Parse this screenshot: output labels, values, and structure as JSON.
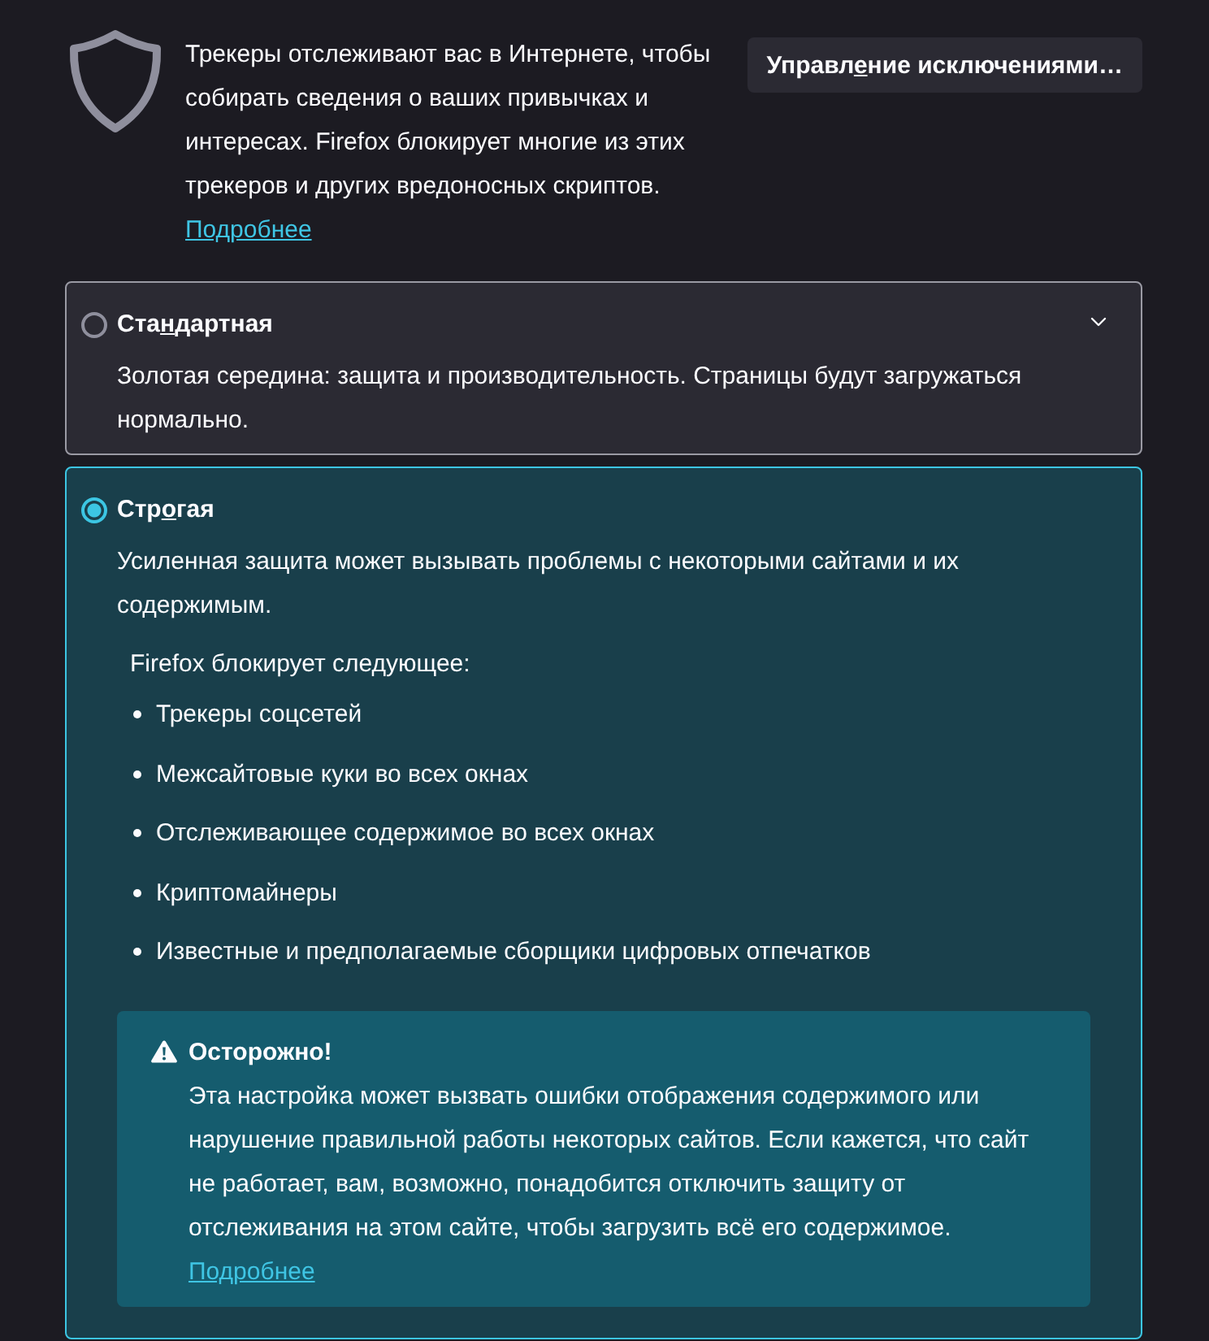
{
  "intro": {
    "text": "Трекеры отслеживают вас в Интернете, чтобы собирать сведения о ваших привычках и интересах. Firefox блокирует многие из этих трекеров и других вредоносных скриптов.",
    "link": "Подробнее"
  },
  "exceptions_button": {
    "label_parts": [
      {
        "text": "Управл",
        "underlined": false
      },
      {
        "text": "е",
        "underlined": true
      },
      {
        "text": "ние исключениями…",
        "underlined": false
      }
    ]
  },
  "options": [
    {
      "title_parts": [
        {
          "text": "Ста",
          "underlined": false
        },
        {
          "text": "н",
          "underlined": true
        },
        {
          "text": "дартная",
          "underlined": false
        }
      ],
      "selected": false,
      "description": "Золотая середина: защита и производительность. Страницы будут загружаться нормально."
    },
    {
      "title_parts": [
        {
          "text": "Стр",
          "underlined": false
        },
        {
          "text": "о",
          "underlined": true
        },
        {
          "text": "гая",
          "underlined": false
        }
      ],
      "selected": true,
      "description": "Усиленная защита может вызывать проблемы с некоторыми сайтами и их содержимым.",
      "blocks_heading": "Firefox блокирует следующее:",
      "blocks": [
        "Трекеры соцсетей",
        "Межсайтовые куки во всех окнах",
        "Отслеживающее содержимое во всех окнах",
        "Криптомайнеры",
        "Известные и предполагаемые сборщики цифровых отпечатков"
      ],
      "warning": {
        "title": "Осторожно!",
        "text": "Эта настройка может вызвать ошибки отображения содержимого или нарушение правильной работы некоторых сайтов. Если кажется, что сайт не работает, вам, возможно, понадобится отключить защиту от отслеживания на этом сайте, чтобы загрузить всё его содержимое.",
        "link": "Подробнее"
      }
    }
  ]
}
